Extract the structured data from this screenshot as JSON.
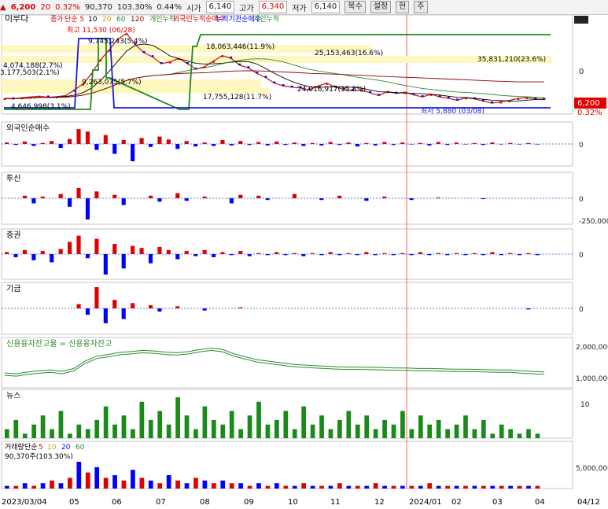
{
  "header": {
    "price": "6,200",
    "price_arrow": "▲",
    "change": "20",
    "change_pct": "0.32%",
    "volume": "90,370",
    "vol_ratio": "103.30%",
    "turnover": "0.44%",
    "open_label": "시가",
    "open": "6,140",
    "high_label": "고가",
    "high": "6,340",
    "low_label": "저가",
    "low": "6,140",
    "buttons": [
      "복수",
      "설정",
      "현",
      "주"
    ]
  },
  "colors": {
    "up": "#e00000",
    "down": "#0000ff",
    "ma5": "#000000",
    "ma20": "#2e8b2e",
    "ma60": "#8b0000",
    "credit": "#2e8b2e",
    "news": "#1a8a1a",
    "highlight": "#fff7c0"
  },
  "chart_data": [
    {
      "type": "line",
      "title": "이루다",
      "legend": [
        "종가",
        "단순 5",
        "10",
        "20",
        "60",
        "120",
        "개인누적",
        "외국인누적순매수",
        "누적기관순매수",
        "개인누적"
      ],
      "x": [
        "2023/03/04",
        "05",
        "06",
        "07",
        "08",
        "09",
        "10",
        "11",
        "12",
        "2024/01",
        "02",
        "03",
        "04",
        "04/12"
      ],
      "price_close": [
        6300,
        6250,
        6350,
        6400,
        6450,
        6380,
        6420,
        6500,
        6900,
        7350,
        8100,
        9100,
        9800,
        10600,
        11000,
        10200,
        9600,
        9300,
        8800,
        8950,
        9200,
        8800,
        8400,
        8600,
        9000,
        9400,
        9200,
        8700,
        8500,
        8100,
        7800,
        7400,
        7200,
        7100,
        7050,
        6900,
        7200,
        7400,
        7100,
        6950,
        6850,
        6900,
        6700,
        6500,
        6800,
        6650,
        6750,
        6550,
        6400,
        6600,
        6400,
        6300,
        6150,
        6350,
        6250,
        6100,
        5950,
        6050,
        6150,
        6300,
        6350,
        6250,
        6200
      ],
      "y_ticks_right": [
        "0",
        "6,200",
        "0.32%"
      ],
      "annotations": [
        "최고 11,530 (06/28)",
        "최저 5,880 (03/08)",
        "9,745,243(5.4%)",
        "4,074,188(2.7%)",
        "3,177,503(2.1%)",
        "9,263,075(5.7%)",
        "18,063,446(11.9%)",
        "25,153,463(16.6%)",
        "35,831,210(23.6%)",
        "24,016,917(15.8%)",
        "17,755,128(11.7%)",
        "4,646,998(3.1%)"
      ]
    },
    {
      "type": "bar",
      "title": "외국인순매수",
      "values": [
        3,
        -2,
        5,
        -4,
        2,
        6,
        -8,
        10,
        30,
        25,
        -12,
        18,
        -20,
        8,
        -35,
        12,
        -6,
        15,
        9,
        -10,
        6,
        -5,
        3,
        -4,
        8,
        -3,
        6,
        -2,
        4,
        -3,
        5,
        -2,
        3,
        -4,
        2,
        -3,
        4,
        -2,
        3,
        -5,
        2,
        -3,
        4,
        -2,
        3,
        -1,
        2,
        -3,
        4,
        -2,
        3,
        -1,
        2,
        -2,
        3,
        -1,
        2,
        -1,
        2,
        -1
      ],
      "ticks": [
        "0"
      ]
    },
    {
      "type": "bar",
      "title": "투신",
      "values": [
        0,
        0,
        3,
        -6,
        2,
        0,
        5,
        -10,
        12,
        -25,
        8,
        0,
        4,
        -8,
        0,
        0,
        3,
        -4,
        0,
        6,
        -3,
        0,
        2,
        0,
        0,
        -6,
        4,
        0,
        3,
        -2,
        0,
        0,
        5,
        0,
        0,
        -2,
        0,
        3,
        0,
        0,
        -3,
        0,
        2,
        0,
        0,
        -2,
        0,
        0,
        1,
        0,
        0,
        0,
        0,
        -1,
        0,
        0,
        0,
        0,
        0,
        0
      ],
      "ticks": [
        "0",
        "-250,000"
      ]
    },
    {
      "type": "bar",
      "title": "증권",
      "values": [
        2,
        -3,
        4,
        -6,
        3,
        -8,
        5,
        12,
        18,
        -4,
        15,
        -20,
        10,
        -14,
        8,
        6,
        -9,
        7,
        4,
        -5,
        3,
        -2,
        4,
        -3,
        2,
        -1,
        3,
        -2,
        1,
        -1,
        2,
        -1,
        1,
        -2,
        1,
        -1,
        2,
        -1,
        1,
        -1,
        2,
        -1,
        1,
        -1,
        1,
        -1,
        2,
        -1,
        1,
        -1,
        1,
        -1,
        1,
        -1,
        2,
        -1,
        1,
        -1,
        1,
        -1
      ],
      "ticks": [
        "0"
      ]
    },
    {
      "type": "bar",
      "title": "기금",
      "values": [
        0,
        0,
        0,
        0,
        0,
        0,
        0,
        0,
        4,
        -6,
        20,
        -14,
        8,
        -10,
        5,
        0,
        3,
        -3,
        0,
        2,
        0,
        0,
        -2,
        0,
        0,
        0,
        1,
        0,
        0,
        0,
        0,
        0,
        0,
        0,
        0,
        0,
        0,
        0,
        0,
        0,
        0,
        0,
        0,
        0,
        0,
        0,
        0,
        0,
        0,
        0,
        0,
        0,
        0,
        0,
        0,
        0,
        0,
        0,
        -1,
        0
      ],
      "ticks": [
        "0"
      ]
    },
    {
      "type": "line",
      "title": "신용융자잔고율",
      "legend": [
        "신용융자잔고율",
        "신용융자잔고"
      ],
      "values": [
        1.15,
        1.12,
        1.18,
        1.22,
        1.25,
        1.2,
        1.3,
        1.55,
        1.72,
        1.78,
        1.85,
        1.88,
        1.92,
        1.9,
        1.86,
        1.84,
        1.88,
        1.95,
        2.0,
        1.95,
        1.8,
        1.7,
        1.6,
        1.55,
        1.5,
        1.45,
        1.42,
        1.4,
        1.38,
        1.36,
        1.35,
        1.35,
        1.34,
        1.33,
        1.32,
        1.32,
        1.3,
        1.3,
        1.29,
        1.28,
        1.28,
        1.27,
        1.26,
        1.25,
        1.25,
        1.22,
        1.2,
        1.18
      ],
      "ticks": [
        "2,000,000",
        "1,000,000"
      ]
    },
    {
      "type": "bar",
      "title": "뉴스",
      "values": [
        2,
        4,
        1,
        3,
        5,
        2,
        6,
        1,
        3,
        2,
        4,
        7,
        3,
        5,
        2,
        8,
        4,
        6,
        3,
        9,
        5,
        2,
        7,
        4,
        3,
        6,
        2,
        5,
        8,
        3,
        4,
        6,
        2,
        7,
        3,
        5,
        2,
        4,
        6,
        3,
        5,
        2,
        4,
        3,
        6,
        2,
        5,
        3,
        4,
        2,
        3,
        5,
        2,
        4,
        1,
        3,
        2,
        1,
        2,
        1
      ],
      "ticks": [
        "10"
      ]
    },
    {
      "type": "bar",
      "title": "거래량",
      "legend": [
        "거래량",
        "단순",
        "5",
        "10",
        "20",
        "60"
      ],
      "label": "90,370주(103.30%)",
      "values": [
        1,
        1,
        2,
        1,
        2,
        3,
        2,
        4,
        10,
        6,
        8,
        4,
        5,
        3,
        7,
        4,
        3,
        2,
        5,
        3,
        2,
        4,
        3,
        2,
        3,
        2,
        2,
        1,
        2,
        1,
        2,
        1,
        1,
        2,
        1,
        1,
        1,
        2,
        1,
        1,
        1,
        2,
        1,
        1,
        1,
        1,
        1,
        2,
        1,
        1,
        1,
        1,
        1,
        1,
        1,
        1,
        1,
        1,
        1,
        1
      ],
      "ticks": [
        "5,000,000"
      ]
    }
  ]
}
